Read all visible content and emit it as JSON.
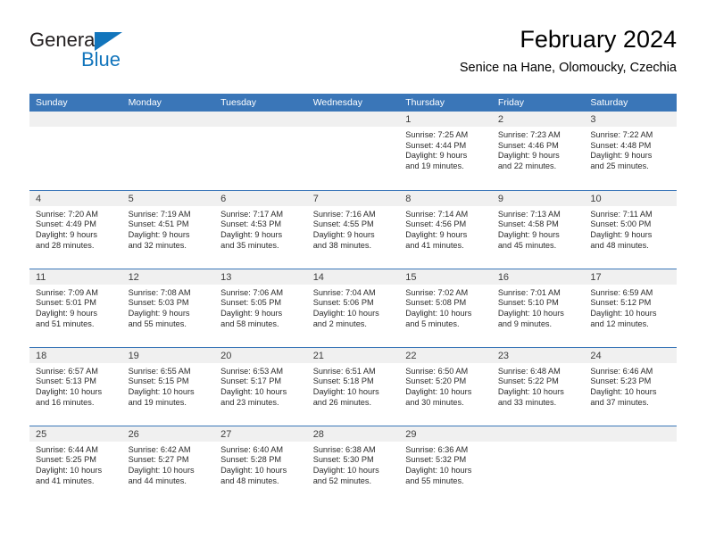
{
  "brand": {
    "name_part1": "General",
    "name_part2": "Blue",
    "triangle_color": "#1275bc"
  },
  "header": {
    "title": "February 2024",
    "subtitle": "Senice na Hane, Olomoucky, Czechia"
  },
  "theme": {
    "header_blue": "#3a76b8",
    "daynum_band": "#f0f0f0",
    "text": "#2b2b2b"
  },
  "calendar": {
    "weekday_headers": [
      "Sunday",
      "Monday",
      "Tuesday",
      "Wednesday",
      "Thursday",
      "Friday",
      "Saturday"
    ],
    "weeks": [
      [
        {
          "day": "",
          "lines": []
        },
        {
          "day": "",
          "lines": []
        },
        {
          "day": "",
          "lines": []
        },
        {
          "day": "",
          "lines": []
        },
        {
          "day": "1",
          "lines": [
            "Sunrise: 7:25 AM",
            "Sunset: 4:44 PM",
            "Daylight: 9 hours",
            "and 19 minutes."
          ]
        },
        {
          "day": "2",
          "lines": [
            "Sunrise: 7:23 AM",
            "Sunset: 4:46 PM",
            "Daylight: 9 hours",
            "and 22 minutes."
          ]
        },
        {
          "day": "3",
          "lines": [
            "Sunrise: 7:22 AM",
            "Sunset: 4:48 PM",
            "Daylight: 9 hours",
            "and 25 minutes."
          ]
        }
      ],
      [
        {
          "day": "4",
          "lines": [
            "Sunrise: 7:20 AM",
            "Sunset: 4:49 PM",
            "Daylight: 9 hours",
            "and 28 minutes."
          ]
        },
        {
          "day": "5",
          "lines": [
            "Sunrise: 7:19 AM",
            "Sunset: 4:51 PM",
            "Daylight: 9 hours",
            "and 32 minutes."
          ]
        },
        {
          "day": "6",
          "lines": [
            "Sunrise: 7:17 AM",
            "Sunset: 4:53 PM",
            "Daylight: 9 hours",
            "and 35 minutes."
          ]
        },
        {
          "day": "7",
          "lines": [
            "Sunrise: 7:16 AM",
            "Sunset: 4:55 PM",
            "Daylight: 9 hours",
            "and 38 minutes."
          ]
        },
        {
          "day": "8",
          "lines": [
            "Sunrise: 7:14 AM",
            "Sunset: 4:56 PM",
            "Daylight: 9 hours",
            "and 41 minutes."
          ]
        },
        {
          "day": "9",
          "lines": [
            "Sunrise: 7:13 AM",
            "Sunset: 4:58 PM",
            "Daylight: 9 hours",
            "and 45 minutes."
          ]
        },
        {
          "day": "10",
          "lines": [
            "Sunrise: 7:11 AM",
            "Sunset: 5:00 PM",
            "Daylight: 9 hours",
            "and 48 minutes."
          ]
        }
      ],
      [
        {
          "day": "11",
          "lines": [
            "Sunrise: 7:09 AM",
            "Sunset: 5:01 PM",
            "Daylight: 9 hours",
            "and 51 minutes."
          ]
        },
        {
          "day": "12",
          "lines": [
            "Sunrise: 7:08 AM",
            "Sunset: 5:03 PM",
            "Daylight: 9 hours",
            "and 55 minutes."
          ]
        },
        {
          "day": "13",
          "lines": [
            "Sunrise: 7:06 AM",
            "Sunset: 5:05 PM",
            "Daylight: 9 hours",
            "and 58 minutes."
          ]
        },
        {
          "day": "14",
          "lines": [
            "Sunrise: 7:04 AM",
            "Sunset: 5:06 PM",
            "Daylight: 10 hours",
            "and 2 minutes."
          ]
        },
        {
          "day": "15",
          "lines": [
            "Sunrise: 7:02 AM",
            "Sunset: 5:08 PM",
            "Daylight: 10 hours",
            "and 5 minutes."
          ]
        },
        {
          "day": "16",
          "lines": [
            "Sunrise: 7:01 AM",
            "Sunset: 5:10 PM",
            "Daylight: 10 hours",
            "and 9 minutes."
          ]
        },
        {
          "day": "17",
          "lines": [
            "Sunrise: 6:59 AM",
            "Sunset: 5:12 PM",
            "Daylight: 10 hours",
            "and 12 minutes."
          ]
        }
      ],
      [
        {
          "day": "18",
          "lines": [
            "Sunrise: 6:57 AM",
            "Sunset: 5:13 PM",
            "Daylight: 10 hours",
            "and 16 minutes."
          ]
        },
        {
          "day": "19",
          "lines": [
            "Sunrise: 6:55 AM",
            "Sunset: 5:15 PM",
            "Daylight: 10 hours",
            "and 19 minutes."
          ]
        },
        {
          "day": "20",
          "lines": [
            "Sunrise: 6:53 AM",
            "Sunset: 5:17 PM",
            "Daylight: 10 hours",
            "and 23 minutes."
          ]
        },
        {
          "day": "21",
          "lines": [
            "Sunrise: 6:51 AM",
            "Sunset: 5:18 PM",
            "Daylight: 10 hours",
            "and 26 minutes."
          ]
        },
        {
          "day": "22",
          "lines": [
            "Sunrise: 6:50 AM",
            "Sunset: 5:20 PM",
            "Daylight: 10 hours",
            "and 30 minutes."
          ]
        },
        {
          "day": "23",
          "lines": [
            "Sunrise: 6:48 AM",
            "Sunset: 5:22 PM",
            "Daylight: 10 hours",
            "and 33 minutes."
          ]
        },
        {
          "day": "24",
          "lines": [
            "Sunrise: 6:46 AM",
            "Sunset: 5:23 PM",
            "Daylight: 10 hours",
            "and 37 minutes."
          ]
        }
      ],
      [
        {
          "day": "25",
          "lines": [
            "Sunrise: 6:44 AM",
            "Sunset: 5:25 PM",
            "Daylight: 10 hours",
            "and 41 minutes."
          ]
        },
        {
          "day": "26",
          "lines": [
            "Sunrise: 6:42 AM",
            "Sunset: 5:27 PM",
            "Daylight: 10 hours",
            "and 44 minutes."
          ]
        },
        {
          "day": "27",
          "lines": [
            "Sunrise: 6:40 AM",
            "Sunset: 5:28 PM",
            "Daylight: 10 hours",
            "and 48 minutes."
          ]
        },
        {
          "day": "28",
          "lines": [
            "Sunrise: 6:38 AM",
            "Sunset: 5:30 PM",
            "Daylight: 10 hours",
            "and 52 minutes."
          ]
        },
        {
          "day": "29",
          "lines": [
            "Sunrise: 6:36 AM",
            "Sunset: 5:32 PM",
            "Daylight: 10 hours",
            "and 55 minutes."
          ]
        },
        {
          "day": "",
          "lines": []
        },
        {
          "day": "",
          "lines": []
        }
      ]
    ]
  }
}
